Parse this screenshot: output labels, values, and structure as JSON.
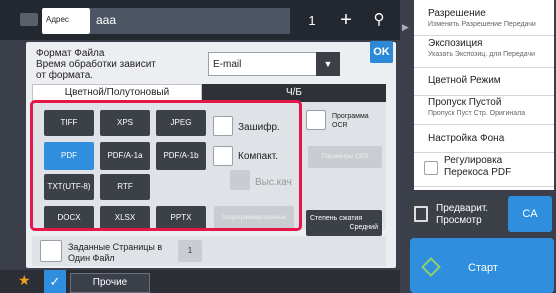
{
  "header": {
    "addr_label": "Адрес",
    "addr_value": "ааа",
    "count": "1",
    "plus": "+",
    "search": "⚲"
  },
  "dialog": {
    "fmt_label": "Формат Файла",
    "fmt_note": "Время обработки зависит от формата.",
    "email": "E-mail",
    "ok": "OK",
    "tab_color": "Цветной/Полутоновый",
    "tab_bw": "Ч/Б",
    "formats": [
      "TIFF",
      "XPS",
      "JPEG",
      "PDF",
      "PDF/A-1a",
      "PDF/A-1b",
      "TXT(UTF-8)",
      "RTF",
      "DOCX",
      "XLSX",
      "PPTX"
    ],
    "selected_format": "PDF",
    "encrypt": "Зашифр.",
    "compact": "Компакт.",
    "hq": "Выс.кач",
    "ocr": "Программа OCR",
    "ocr_params": "Параметры OCR",
    "disabled_btn": "Запрограммированные",
    "compress_title": "Степень сжатия",
    "compress_value": "Средний",
    "pages_label": "Заданные Страницы в Один Файл",
    "pages_num": "1"
  },
  "bottom": {
    "others": "Прочие"
  },
  "sidebar": {
    "items": [
      {
        "t": "Разрешение",
        "s": "Изменить Разрешение Передачи"
      },
      {
        "t": "Экспозиция",
        "s": "Указать Экспозиц. для Передачи"
      },
      {
        "t": "Цветной Режим",
        "s": ""
      },
      {
        "t": "Пропуск Пустой",
        "s": "Пропуск Пуст Стр. Оригинала"
      },
      {
        "t": "Настройка Фона",
        "s": ""
      },
      {
        "t": "Регулировка Перекоса PDF",
        "s": ""
      }
    ],
    "preview": "Предварит. Просмотр",
    "ca": "CA",
    "start": "Старт"
  }
}
